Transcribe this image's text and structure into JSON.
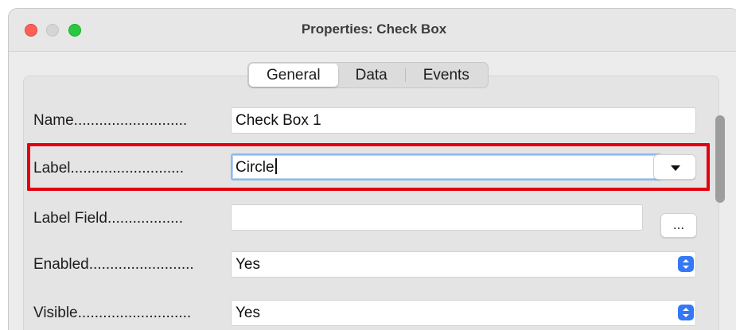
{
  "window": {
    "title": "Properties: Check Box"
  },
  "tabs": [
    {
      "label": "General",
      "active": true
    },
    {
      "label": "Data",
      "active": false
    },
    {
      "label": "Events",
      "active": false
    }
  ],
  "rows": {
    "name": {
      "label": "Name...........................",
      "value": "Check Box 1"
    },
    "label": {
      "label": "Label...........................",
      "value": "Circle"
    },
    "label_field": {
      "label": "Label Field..................",
      "value": "",
      "button": "..."
    },
    "enabled": {
      "label": "Enabled.........................",
      "value": "Yes"
    },
    "visible": {
      "label": "Visible...........................",
      "value": "Yes"
    }
  },
  "colors": {
    "highlight": "#e3000f",
    "accent": "#3478f6",
    "close": "#ff5f57",
    "zoom": "#28c840"
  },
  "icons": {
    "dropdown": "triangle-down",
    "stepper": "up-down-chevrons"
  }
}
